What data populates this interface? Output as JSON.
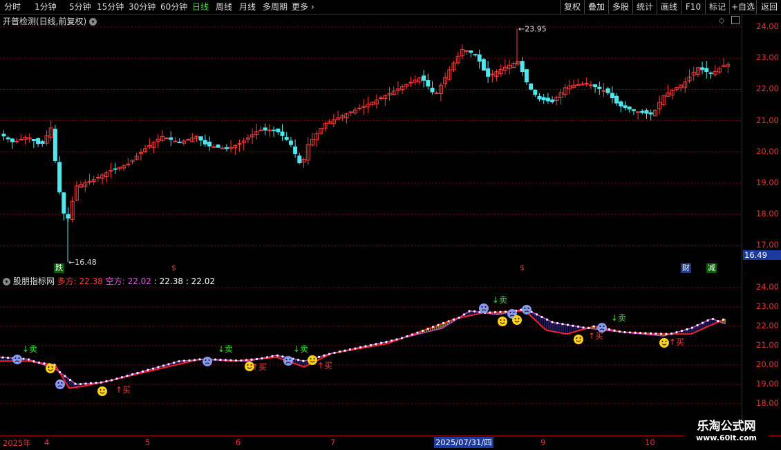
{
  "toolbar": {
    "periods": [
      "分时",
      "1分钟",
      "5分钟",
      "15分钟",
      "30分钟",
      "60分钟",
      "日线",
      "周线",
      "月线",
      "多周期",
      "更多"
    ],
    "active_period": "日线",
    "right_buttons": [
      "复权",
      "叠加",
      "多股",
      "统计",
      "画线",
      "F10",
      "标记",
      "+自选",
      "返回"
    ]
  },
  "main": {
    "title": "开普检测(日线,前复权)",
    "high_label": "23.95",
    "low_label": "16.48",
    "current_price": "16.49",
    "markers": {
      "die": "跌",
      "cai": "财",
      "jian": "减",
      "dollar": "$"
    },
    "yticks": [
      "24.00",
      "23.00",
      "22.00",
      "21.00",
      "20.00",
      "19.00",
      "18.00",
      "17.00"
    ]
  },
  "sub": {
    "title": "股朋指标网",
    "duo_label": "多方: 22.38",
    "kong_label": "空方: 22.02",
    "v1": ": 22.38",
    "v2": ": 22.02",
    "sell": "↓卖",
    "buy": "↑买",
    "yticks": [
      "24.00",
      "23.00",
      "22.00",
      "21.00",
      "20.00",
      "19.00",
      "18.00"
    ]
  },
  "xaxis": {
    "labels": [
      "2025年",
      "4",
      "5",
      "6",
      "7",
      "8",
      "9",
      "10"
    ],
    "cursor_date": "2025/07/31/四"
  },
  "watermark": {
    "name": "乐淘公式网",
    "url": "www.60lt.com"
  },
  "colors": {
    "up": "#ff3b3b",
    "down": "#4fe6ee",
    "bull": "#ffff33",
    "bear": "#3333cc",
    "grid": "#8b0000"
  }
}
